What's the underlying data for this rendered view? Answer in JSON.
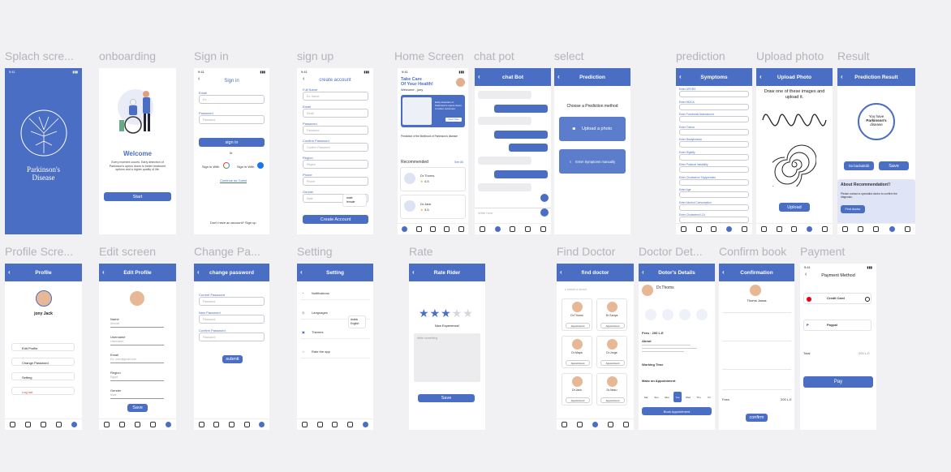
{
  "screens": {
    "splash": {
      "label": "Splach scre...",
      "title_line1": "Parkinson's",
      "title_line2": "Disease"
    },
    "onboarding": {
      "label": "onboarding",
      "heading": "Welcome",
      "body": "Every moment counts. Early detection of Parkinson's opens doors to better treatment options and a higher quality of life.",
      "button": "Start"
    },
    "signin": {
      "label": "Sign in",
      "title": "Sign in",
      "email_label": "Email",
      "email_placeholder": "Ex: ...",
      "password_label": "Password",
      "password_placeholder": "Password",
      "button": "sign in",
      "or": "0r",
      "with_google": "Sign in With",
      "with_facebook": "Sign in With",
      "continue_guest": "Continue as Guest",
      "footer": "Don't have an account?  Sign up"
    },
    "signup": {
      "label": "sign up",
      "title": "create account",
      "fields": [
        "Full Name",
        "Email",
        "Password",
        "Confirm Password",
        "Region",
        "Phone",
        "Gender"
      ],
      "placeholders": [
        "Ex: Name",
        "Email",
        "Password",
        "Confirm Password",
        "Region",
        "Phone",
        "Male"
      ],
      "gender_options": [
        "male",
        "female"
      ],
      "button": "Create Account"
    },
    "home": {
      "label": "Home Screen",
      "greeting1": "Take Care",
      "greeting2": "Of Your Health!",
      "welcome": "Welcome , jony",
      "banner_text": "Early detection of Parkinson's opens doors to better outcomes",
      "banner_btn": "Start Now",
      "prediction_text": "Prediction of the likelihood of Parkinson's disease",
      "recommended": "Recommended",
      "see_all": "See All",
      "doctors": [
        {
          "name": "Dr.Thoms",
          "rating": "4.5"
        },
        {
          "name": "Dr.Jack",
          "rating": "3.5"
        }
      ]
    },
    "chat": {
      "label": "chat pot",
      "title": "chat Bot",
      "input_placeholder": "Write here"
    },
    "select": {
      "label": "select",
      "title": "Prediction",
      "heading": "Choose a Prediction method",
      "opt1": "Upload a photo",
      "opt2": "Enter Symptoms manually"
    },
    "prediction": {
      "label": "prediction",
      "title": "Symptoms",
      "fields": [
        "Enter UPDRS",
        "Enter MOCA",
        "Enter Functional Assessment",
        "Enter Tremor",
        "Enter Bradykinesia",
        "Enter Rigidity",
        "Enter Postural Instability",
        "Enter Cholesterol Triglycerides",
        "Enter Age",
        "Enter Alcohol Consumption",
        "Enter Cholesterol LDL"
      ]
    },
    "upload": {
      "label": "Upload photo",
      "title": "Upload Photo",
      "heading": "Draw one of these images and upload it.",
      "button": "Upload"
    },
    "result": {
      "label": "Result",
      "title": "Prediction Result",
      "circle_text1": "You have",
      "circle_text2": "Parkinson's",
      "circle_text3": "disease",
      "back_btn": "Go back&Edit",
      "save_btn": "Save",
      "about_title": "About Recommendation!!",
      "about_body": "Please contact a specialist doctor to confirm the diagnosis.",
      "find_btn": "Find doctor"
    },
    "profile": {
      "label": "Profile Scre...",
      "title": "Profile",
      "name": "jony Jack",
      "menu": [
        "Edit Profile",
        "Change Password",
        "Setting",
        "Log out"
      ]
    },
    "edit": {
      "label": "Edit screen",
      "title": "Edit Profile",
      "fields": [
        "Name",
        "Username",
        "Email",
        "Region",
        "Gender"
      ],
      "placeholders": [
        "Ahmad",
        "Username",
        "Ex: user@gmail.com",
        "Egypt",
        "Male"
      ],
      "button": "Save"
    },
    "change": {
      "label": "Change Pa...",
      "title": "change password",
      "fields": [
        "Current Password",
        "New Password",
        "Confirm Password"
      ],
      "placeholders": [
        "Password",
        "Password",
        "Password"
      ],
      "button": "submit"
    },
    "setting": {
      "label": "Setting",
      "title": "Setting",
      "items": [
        "Notifications",
        "Languages",
        "Themes",
        "Rate the app"
      ],
      "lang_options": [
        "Arabic",
        "English"
      ]
    },
    "rate": {
      "label": "Rate",
      "title": "Rate Rider",
      "caption": "Nice Experience!",
      "placeholder": "Write something",
      "button": "Save"
    },
    "find": {
      "label": "Find Doctor",
      "title": "find doctor",
      "search": "search a doctor",
      "doctors": [
        "Dr.Thoms",
        "Dr.Sanya",
        "Dr.Maya",
        "Dr.Jorge",
        "Dr.Jack",
        "Dr.Nesu"
      ],
      "appointment": "Appointment"
    },
    "details": {
      "label": "Doctor Det...",
      "title": "Dotor's Details",
      "name": "Dr.Thoms",
      "fees": "Fees : 200 L.E",
      "about": "About",
      "working": "Working Time",
      "make": "Make an Appointment",
      "days": [
        "Sat",
        "Sun",
        "Mon",
        "Tue",
        "Wed",
        "Thu",
        "Fri"
      ],
      "button": "Book Appointment"
    },
    "confirm": {
      "label": "Confirm book",
      "title": "Confirmation",
      "name": "Thoms Jonas",
      "button": "confirm",
      "fees": "Fees",
      "fees_value": "200 L.E"
    },
    "payment": {
      "label": "Payment",
      "title": "Payment  Method",
      "card1": "Credit Card",
      "card2": "Paypal",
      "total": "Total",
      "total_value": "200 L.E",
      "button": "Pay"
    }
  },
  "colors": {
    "primary": "#4a6ec4",
    "bg": "#f1f1f3",
    "star": "#4a6ec4"
  }
}
